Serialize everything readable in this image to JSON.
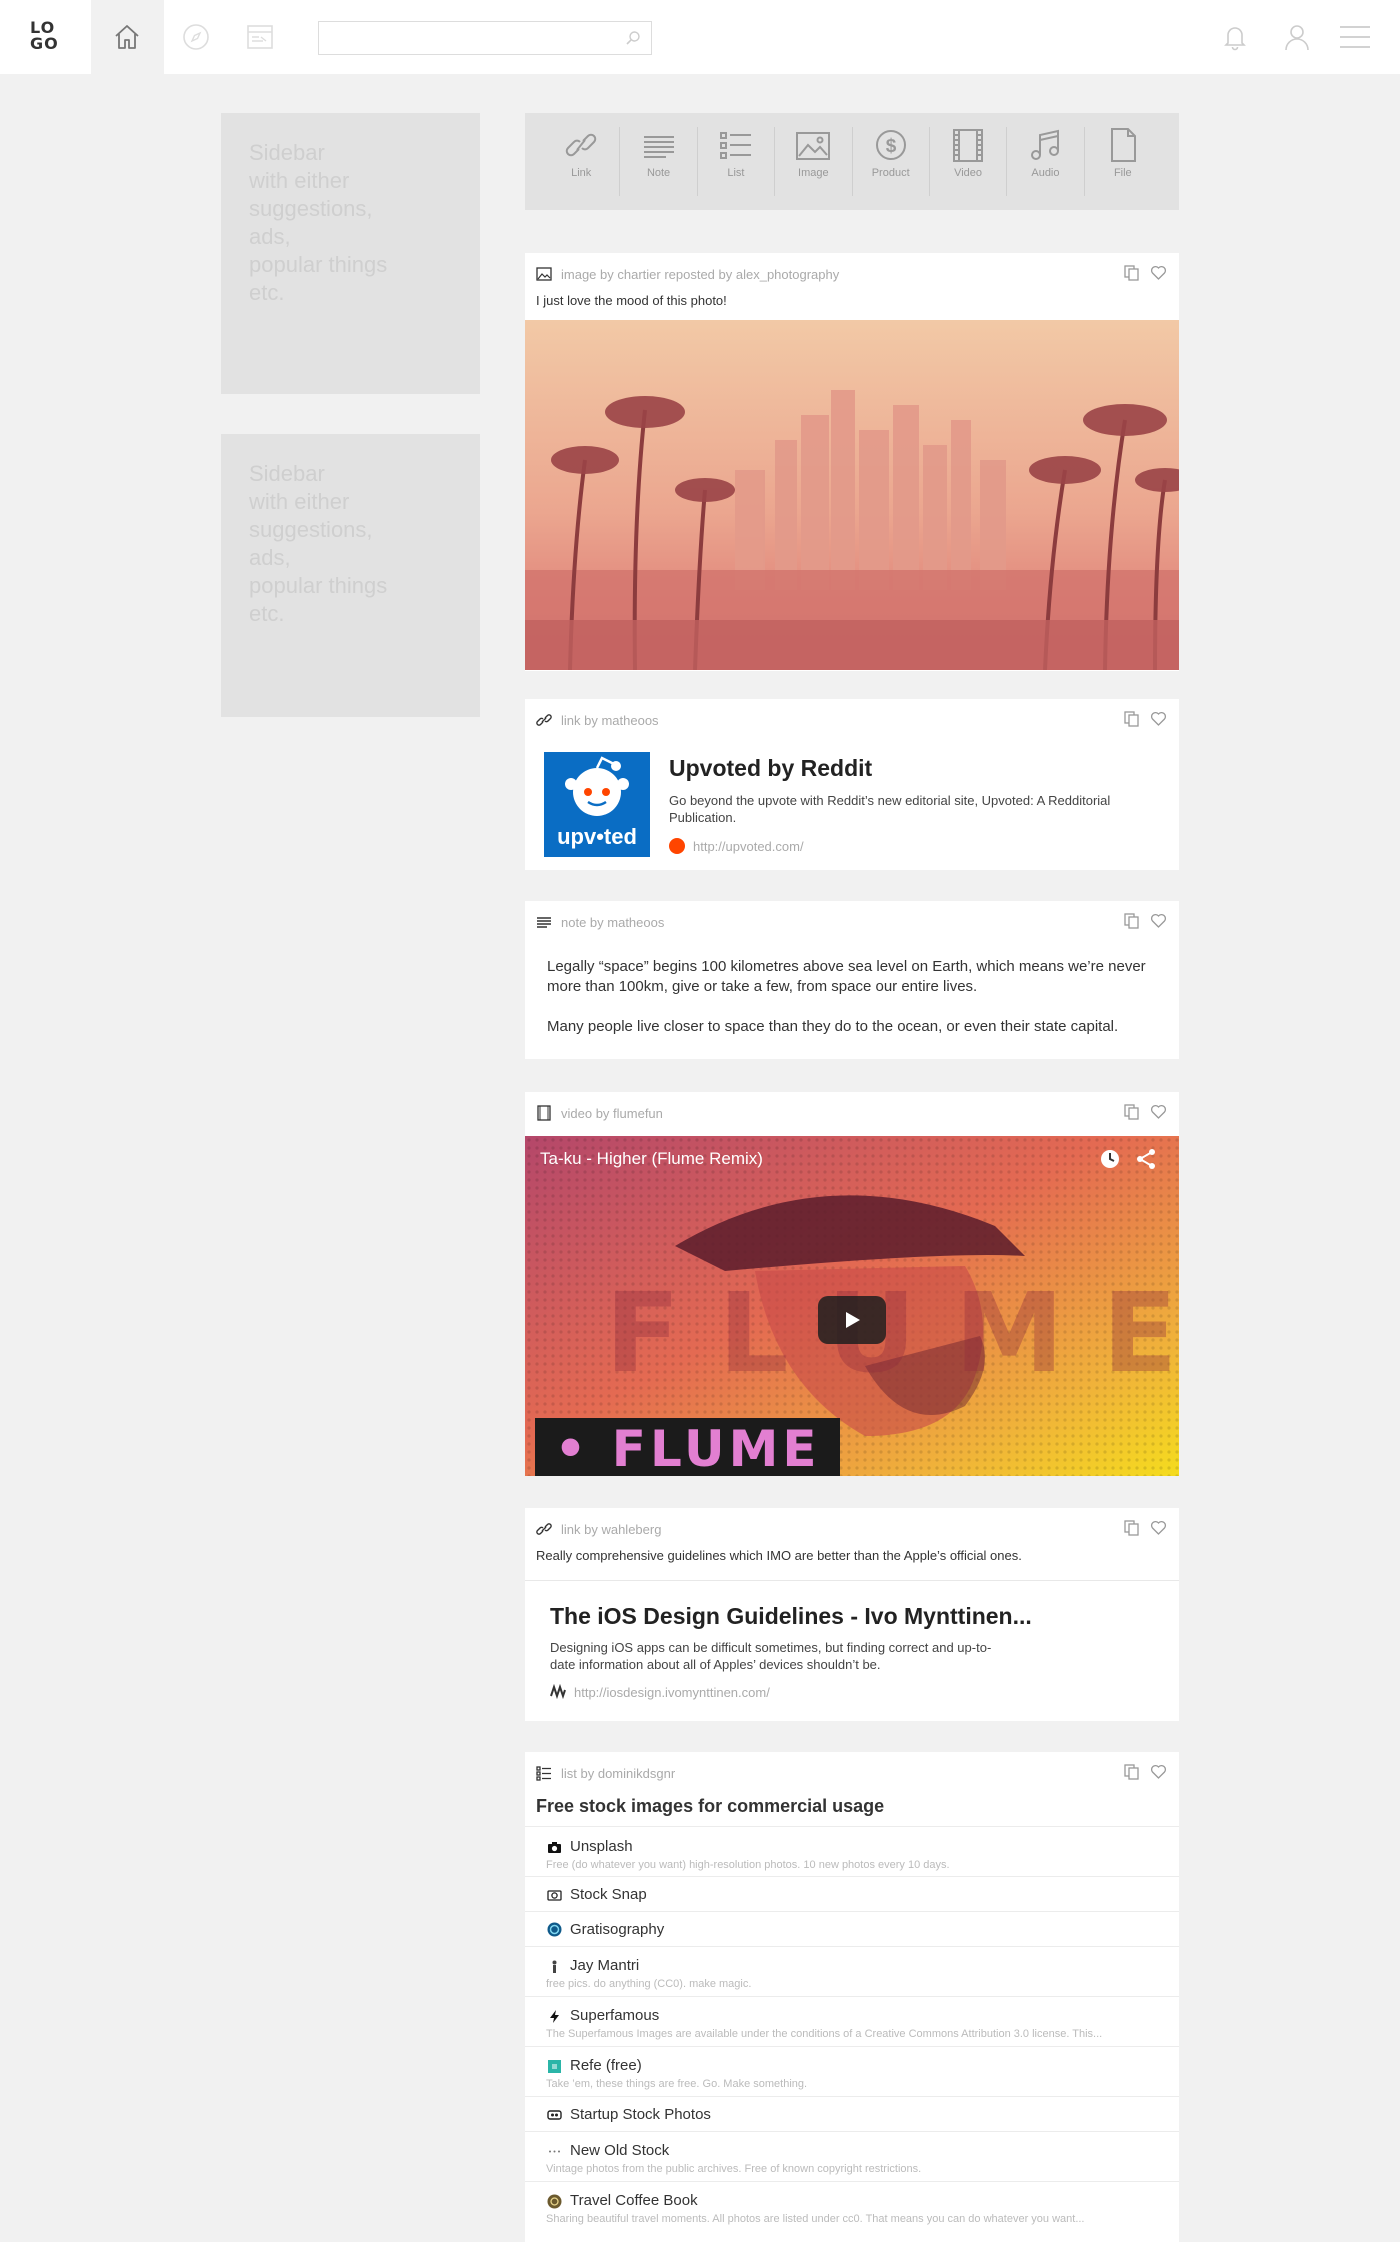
{
  "header": {
    "logo": "LO GO",
    "logo_top": "LO",
    "logo_bottom": "GO",
    "search_placeholder": ""
  },
  "sidebar": {
    "boxes": [
      {
        "text": "Sidebar\nwith either\nsuggestions,\nads,\npopular things\netc."
      },
      {
        "text": "Sidebar\nwith either\nsuggestions,\nads,\npopular things\netc."
      }
    ]
  },
  "composer": {
    "items": [
      {
        "label": "Link",
        "icon": "link-icon"
      },
      {
        "label": "Note",
        "icon": "note-icon"
      },
      {
        "label": "List",
        "icon": "list-icon"
      },
      {
        "label": "Image",
        "icon": "image-icon"
      },
      {
        "label": "Product",
        "icon": "dollar-icon"
      },
      {
        "label": "Video",
        "icon": "film-icon"
      },
      {
        "label": "Audio",
        "icon": "music-icon"
      },
      {
        "label": "File",
        "icon": "file-icon"
      }
    ]
  },
  "posts": {
    "image": {
      "meta": "image by chartier reposted by alex_photography",
      "caption": "I just love the mood of this photo!"
    },
    "link1": {
      "meta": "link by matheoos",
      "thumb_text": "upv•ted",
      "title": "Upvoted by Reddit",
      "desc": "Go beyond the upvote with Reddit’s new editorial site, Upvoted: A Redditorial Publication.",
      "url": "http://upvoted.com/"
    },
    "note": {
      "meta": "note by matheoos",
      "para1": "Legally “space” begins 100 kilometres above sea level on Earth, which means we’re never more than 100km, give or take a few, from space our entire lives.",
      "para2": "Many people live closer to space than they do to the ocean, or even their state capital."
    },
    "video": {
      "meta": "video by flumefun",
      "title": "Ta-ku - Higher (Flume Remix)",
      "overlay": "• FLUME •"
    },
    "link2": {
      "meta": "link by wahleberg",
      "caption": "Really comprehensive guidelines which IMO are better than the Apple’s official ones.",
      "title": "The iOS Design Guidelines - Ivo Mynttinen...",
      "desc": "Designing iOS apps can be difficult sometimes, but finding correct and up-to-date information about all of Apples’ devices shouldn’t be.",
      "url": "http://iosdesign.ivomynttinen.com/"
    },
    "list": {
      "meta": "list by dominikdsgnr",
      "title": "Free stock images for commercial usage",
      "items": [
        {
          "name": "Unsplash",
          "desc": "Free (do whatever you want) high-resolution photos. 10 new photos every 10 days."
        },
        {
          "name": "Stock Snap",
          "desc": ""
        },
        {
          "name": "Gratisography",
          "desc": ""
        },
        {
          "name": "Jay Mantri",
          "desc": "free pics. do anything (CC0). make magic."
        },
        {
          "name": "Superfamous",
          "desc": "The Superfamous Images are available under the conditions of a Creative Commons Attribution 3.0 license. This..."
        },
        {
          "name": "Refe (free)",
          "desc": "Take ’em, these things are free. Go. Make something."
        },
        {
          "name": "Startup Stock Photos",
          "desc": ""
        },
        {
          "name": "New Old Stock",
          "desc": "Vintage photos from the public archives. Free of known copyright restrictions."
        },
        {
          "name": "Travel Coffee Book",
          "desc": "Sharing beautiful travel moments. All photos are listed under cc0. That means you can do whatever you want..."
        }
      ]
    }
  },
  "colors": {
    "background": "#f1f1f1",
    "sidebar_box": "#e2e2e2",
    "reddit_blue": "#0a6dc4",
    "reddit_orange": "#ff4500"
  }
}
